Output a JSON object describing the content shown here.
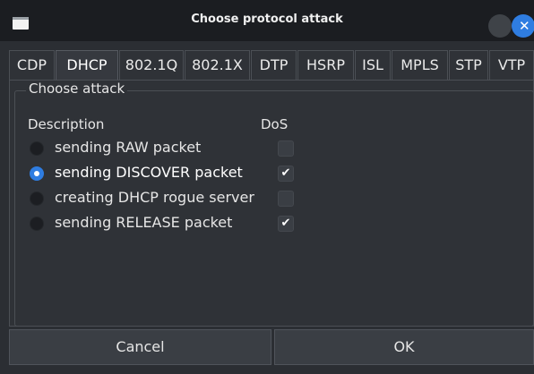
{
  "window": {
    "title": "Choose protocol attack",
    "close_glyph": "✕"
  },
  "tabs": [
    {
      "label": "CDP",
      "active": false
    },
    {
      "label": "DHCP",
      "active": true
    },
    {
      "label": "802.1Q",
      "active": false
    },
    {
      "label": "802.1X",
      "active": false
    },
    {
      "label": "DTP",
      "active": false
    },
    {
      "label": "HSRP",
      "active": false
    },
    {
      "label": "ISL",
      "active": false
    },
    {
      "label": "MPLS",
      "active": false
    },
    {
      "label": "STP",
      "active": false
    },
    {
      "label": "VTP",
      "active": false
    }
  ],
  "group": {
    "title": "Choose attack",
    "col_description": "Description",
    "col_dos": "DoS",
    "attacks": [
      {
        "label": "sending RAW packet",
        "selected": false,
        "dos": false
      },
      {
        "label": "sending DISCOVER packet",
        "selected": true,
        "dos": true
      },
      {
        "label": "creating DHCP rogue server",
        "selected": false,
        "dos": false
      },
      {
        "label": "sending RELEASE packet",
        "selected": false,
        "dos": true
      }
    ]
  },
  "buttons": {
    "cancel": "Cancel",
    "ok": "OK"
  },
  "colors": {
    "accent": "#2f7de1",
    "background": "#2b2e33",
    "titlebar": "#1b1d21"
  }
}
